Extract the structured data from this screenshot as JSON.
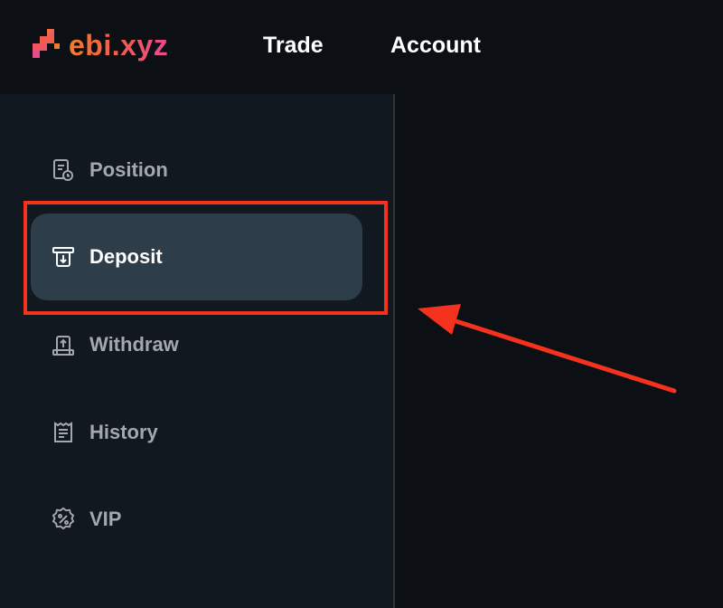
{
  "header": {
    "logo_text": "ebi.xyz",
    "nav": [
      {
        "label": "Trade"
      },
      {
        "label": "Account"
      }
    ]
  },
  "sidebar": {
    "items": [
      {
        "label": "Position",
        "icon": "position-icon",
        "active": false
      },
      {
        "label": "Deposit",
        "icon": "deposit-icon",
        "active": true
      },
      {
        "label": "Withdraw",
        "icon": "withdraw-icon",
        "active": false
      },
      {
        "label": "History",
        "icon": "history-icon",
        "active": false
      },
      {
        "label": "VIP",
        "icon": "vip-icon",
        "active": false
      }
    ]
  },
  "colors": {
    "brand_gradient": [
      "#f47b2a",
      "#e94a8c"
    ],
    "active_item_bg": "#2d3d4a",
    "annotation": "#f5321e"
  }
}
